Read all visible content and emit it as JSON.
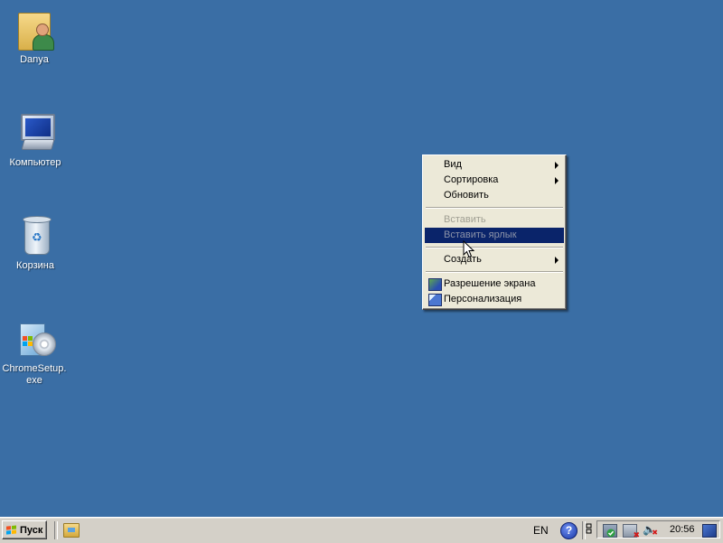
{
  "desktop": {
    "background": "#3a6ea5",
    "icons": [
      {
        "label": "Danya",
        "icon": "user-folder-icon"
      },
      {
        "label": "Компьютер",
        "icon": "computer-icon"
      },
      {
        "label": "Корзина",
        "icon": "recycle-bin-icon"
      },
      {
        "label": "ChromeSetup.exe",
        "icon": "installer-icon"
      }
    ]
  },
  "context_menu": {
    "items": [
      {
        "label": "Вид",
        "submenu": true,
        "enabled": true
      },
      {
        "label": "Сортировка",
        "submenu": true,
        "enabled": true
      },
      {
        "label": "Обновить",
        "enabled": true
      },
      {
        "label": "Вставить",
        "enabled": false
      },
      {
        "label": "Вставить ярлык",
        "enabled": false,
        "highlighted": true
      },
      {
        "label": "Создать",
        "submenu": true,
        "enabled": true
      },
      {
        "label": "Разрешение экрана",
        "icon": "display-settings-icon",
        "enabled": true
      },
      {
        "label": "Персонализация",
        "icon": "personalization-icon",
        "enabled": true
      }
    ],
    "highlight_color": "#0a246a"
  },
  "taskbar": {
    "start_label": "Пуск",
    "language": "EN",
    "help_label": "?",
    "clock": "20:56"
  }
}
